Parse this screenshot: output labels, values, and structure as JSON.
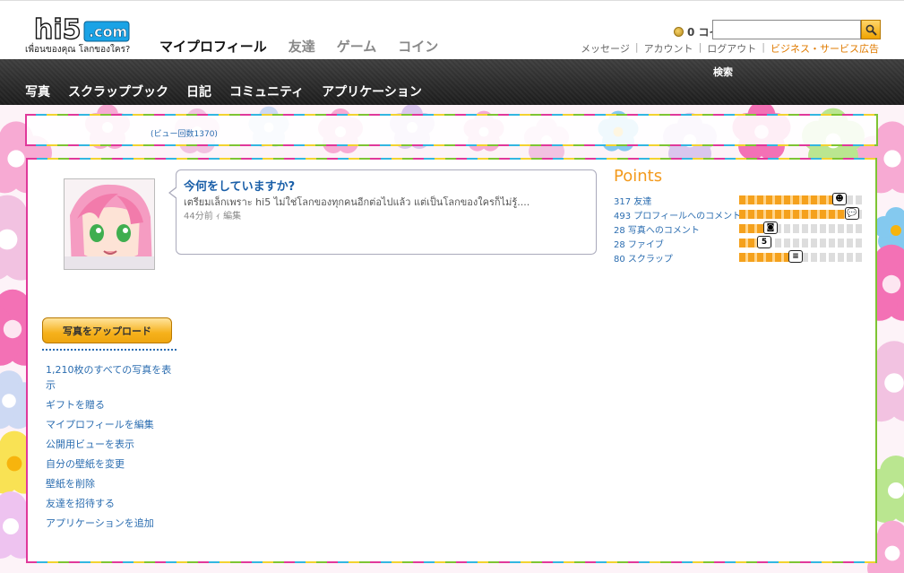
{
  "header": {
    "logo_text": "hi5.com",
    "tagline": "เพื่อนของคุณ โลกของใคร?",
    "tabs": [
      {
        "label": "マイプロフィール",
        "active": true
      },
      {
        "label": "友達",
        "active": false
      },
      {
        "label": "ゲーム",
        "active": false
      },
      {
        "label": "コイン",
        "active": false
      }
    ],
    "coins_label": "0 コイン",
    "util_links": [
      "メッセージ",
      "アカウント",
      "ログアウト",
      "ビジネス・サービス広告"
    ]
  },
  "subnav": {
    "items": [
      "写真",
      "スクラップブック",
      "日記",
      "コミュニティ",
      "アプリケーション"
    ],
    "search_label": "検索",
    "search_placeholder": ""
  },
  "banner": {
    "view_count": "(ビュー回数1370)"
  },
  "status": {
    "title": "今何をしていますか?",
    "text": "เตรียมเล็กเพราะ hi5 ไม่ใช่โลกของทุกคนอีกต่อไปแล้ว แต่เป็นโลกของใครก็ไม่รู้....",
    "time": "44分前",
    "separator": "ｨ",
    "edit": "編集"
  },
  "points": {
    "title": "Points",
    "rows": [
      {
        "label": "317 友達",
        "level": 0.8,
        "icon": "person-icon",
        "icon_text": "☻"
      },
      {
        "label": "493 プロフィールへのコメント",
        "level": 0.9,
        "icon": "speech-bubble-icon",
        "icon_text": "💬"
      },
      {
        "label": "28 写真へのコメント",
        "level": 0.25,
        "icon": "camera-icon",
        "icon_text": "◙"
      },
      {
        "label": "28 ファイブ",
        "level": 0.2,
        "icon": "five-icon",
        "icon_text": "5"
      },
      {
        "label": "80 スクラップ",
        "level": 0.45,
        "icon": "scrap-icon",
        "icon_text": "≡"
      }
    ]
  },
  "sidebar": {
    "upload_label": "写真をアップロード",
    "links": [
      "1,210枚のすべての写真を表示",
      "ギフトを贈る",
      "マイプロフィールを編集",
      "公開用ビューを表示",
      "自分の壁紙を変更",
      "壁紙を削除",
      "友達を招待する",
      "アプリケーションを追加"
    ]
  },
  "colors": {
    "link": "#2b6db0",
    "points_title": "#f39a1d",
    "nav_bg": "#2a2a2a",
    "biz_link": "#e07b00"
  }
}
